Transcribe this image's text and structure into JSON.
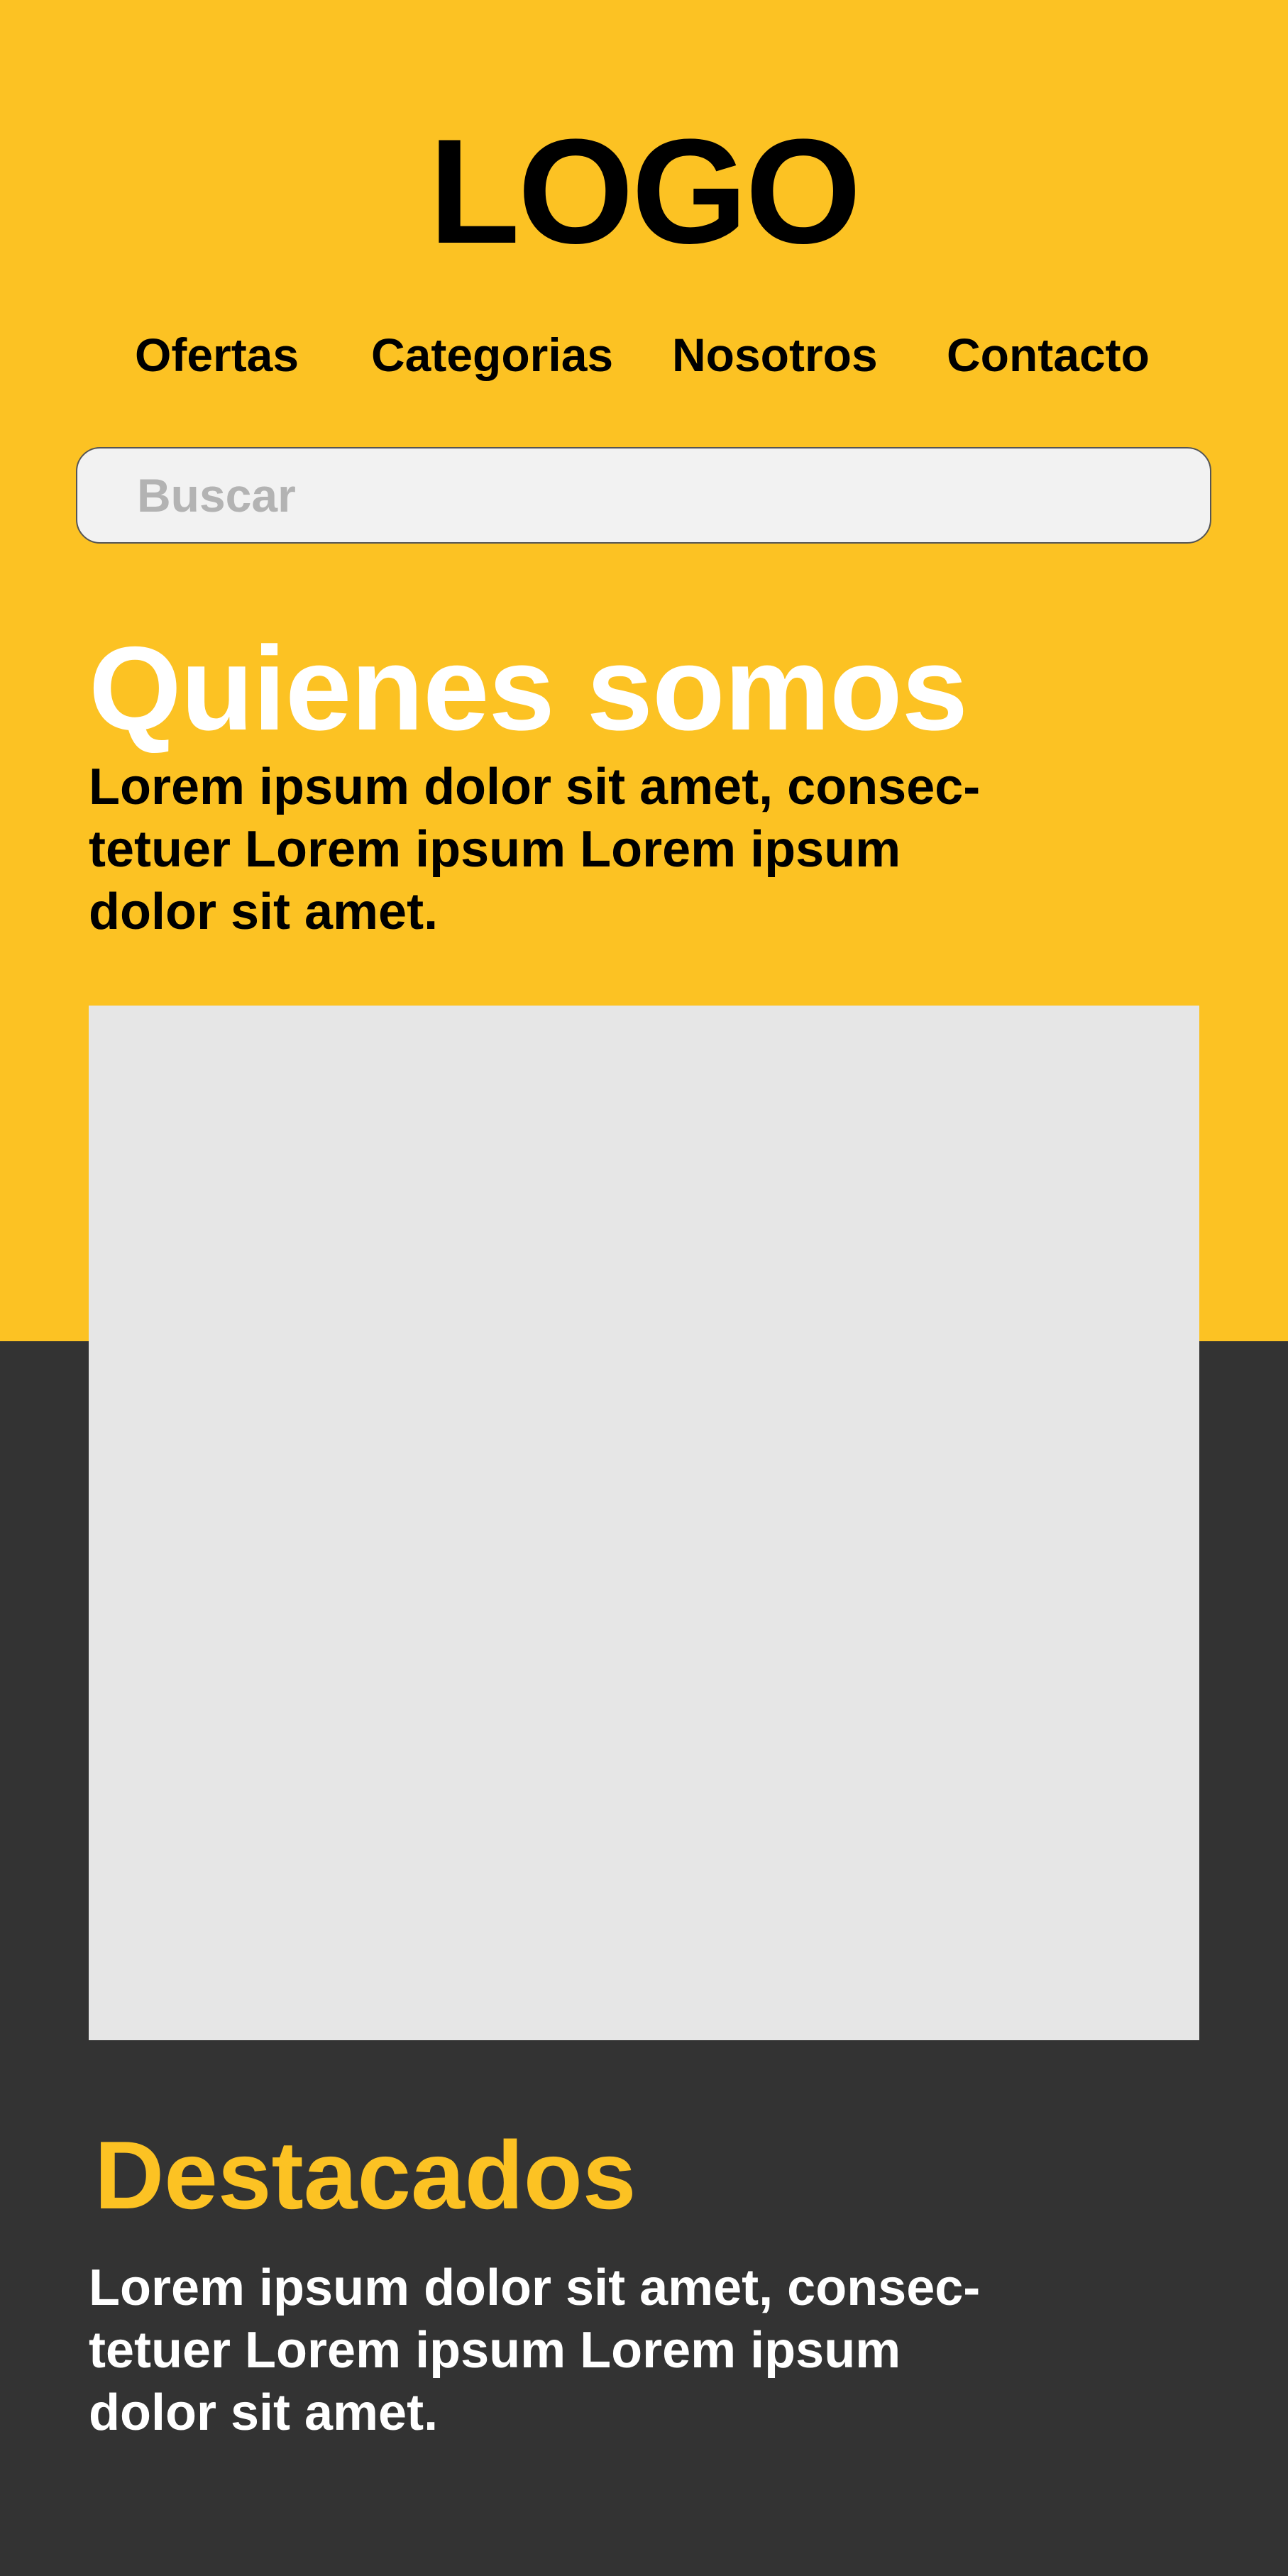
{
  "header": {
    "logo": "LOGO"
  },
  "nav": {
    "items": [
      {
        "label": "Ofertas"
      },
      {
        "label": "Categorias"
      },
      {
        "label": "Nosotros"
      },
      {
        "label": "Contacto"
      }
    ]
  },
  "search": {
    "placeholder": "Buscar",
    "value": ""
  },
  "about": {
    "title": "Quienes somos",
    "text_lines": [
      "Lorem ipsum dolor sit amet, consec-",
      "tetuer Lorem ipsum Lorem ipsum",
      "dolor sit amet."
    ]
  },
  "featured": {
    "title": "Destacados",
    "text_lines": [
      "Lorem ipsum dolor sit amet, consec-",
      "tetuer Lorem ipsum Lorem ipsum",
      "dolor sit amet."
    ]
  },
  "colors": {
    "brand_yellow": "#FCC223",
    "dark_background": "#333333",
    "placeholder_gray": "#E6E6E6",
    "search_background": "#F2F2F2"
  }
}
